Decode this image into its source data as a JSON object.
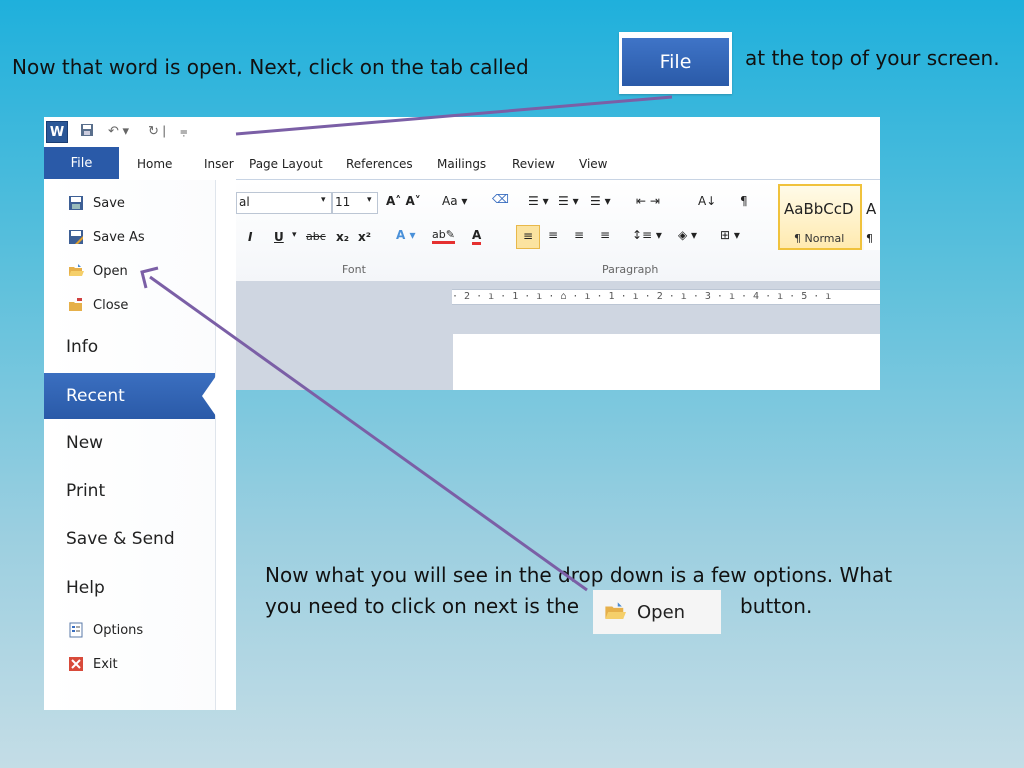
{
  "slide": {
    "intro_before": "Now that word is open. Next, click on the tab called",
    "intro_after": "at the top of your screen.",
    "file_callout_label": "File",
    "instruction_line1": "Now what you will see in the drop down is a few options. What",
    "instruction_line2": "you need to click on next is the",
    "instruction_after": "button.",
    "open_callout_label": "Open"
  },
  "word": {
    "logo": "W",
    "tabs": [
      "File",
      "Home",
      "Inser",
      "Page Layout",
      "References",
      "Mailings",
      "Review",
      "View"
    ],
    "ribbon": {
      "font_name": "al",
      "font_size": "11",
      "font_group": "Font",
      "paragraph_group": "Paragraph",
      "style_sample": "AaBbCcD",
      "style_name": "¶ Normal",
      "style_next": "A",
      "style_next2": "¶"
    },
    "ruler": "· 2 · ı · 1 · ı · ⌂ · ı · 1 · ı · 2 · ı · 3 · ı · 4 · ı · 5 · ı"
  },
  "backstage": {
    "save": "Save",
    "save_as": "Save As",
    "open": "Open",
    "close": "Close",
    "info": "Info",
    "recent": "Recent",
    "new": "New",
    "print": "Print",
    "save_send": "Save & Send",
    "help": "Help",
    "options": "Options",
    "exit": "Exit"
  },
  "colors": {
    "file_blue": "#2a5aa8",
    "arrow_purple": "#7b5fa6",
    "bg_top": "#1fb0dc",
    "bg_bottom": "#c4dde6"
  }
}
